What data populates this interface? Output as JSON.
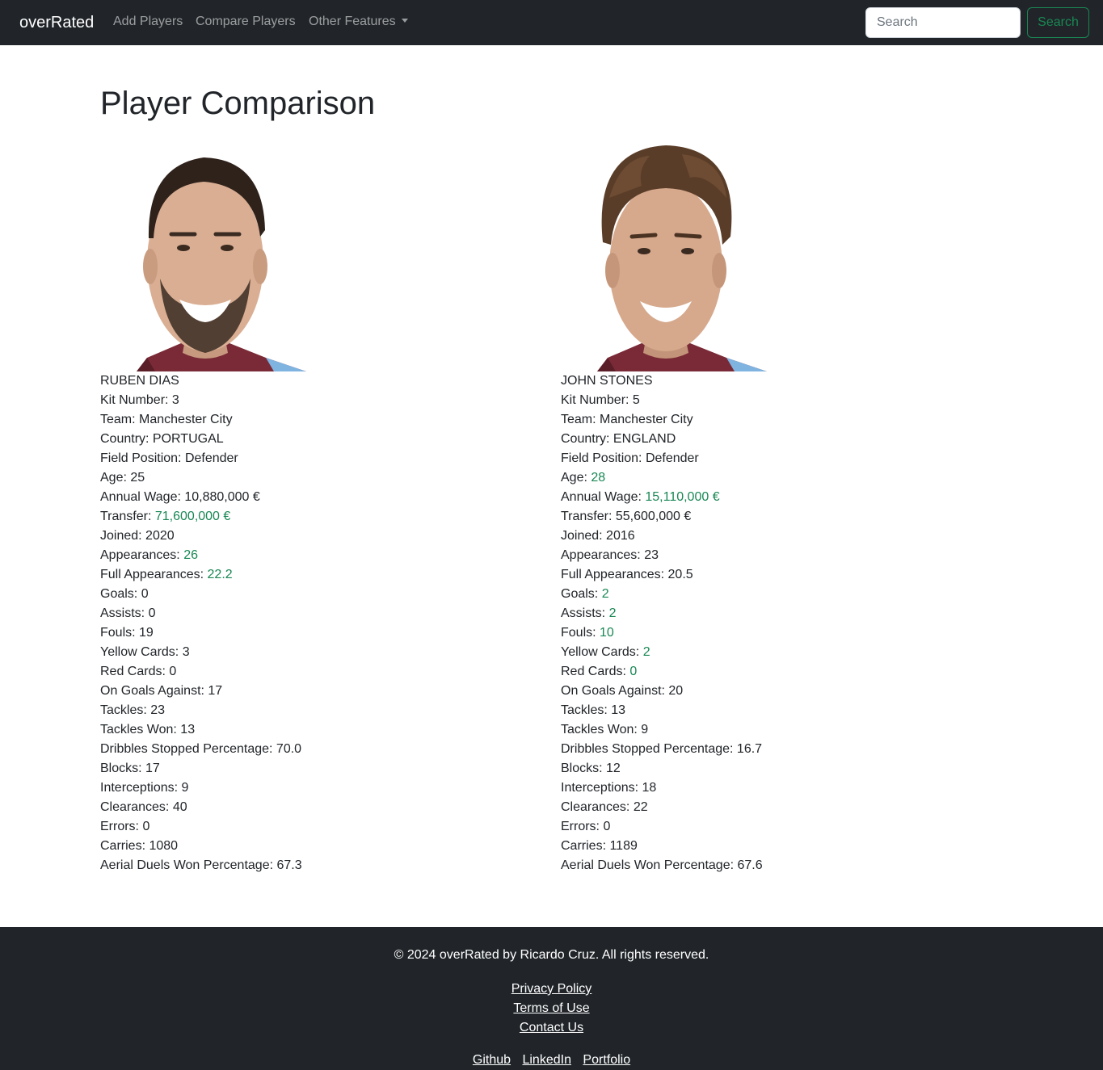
{
  "navbar": {
    "brand": "overRated",
    "links": [
      "Add Players",
      "Compare Players",
      "Other Features"
    ],
    "search_placeholder": "Search",
    "search_button": "Search"
  },
  "page": {
    "title": "Player Comparison"
  },
  "players": [
    {
      "name": "RUBEN DIAS",
      "stats": [
        {
          "label": "Kit Number: ",
          "value": "3",
          "better": false
        },
        {
          "label": "Team: ",
          "value": "Manchester City",
          "better": false
        },
        {
          "label": "Country: ",
          "value": "PORTUGAL",
          "better": false
        },
        {
          "label": "Field Position: ",
          "value": "Defender",
          "better": false
        },
        {
          "label": "Age: ",
          "value": "25",
          "better": false
        },
        {
          "label": "Annual Wage: ",
          "value": "10,880,000 €",
          "better": false
        },
        {
          "label": "Transfer: ",
          "value": "71,600,000 €",
          "better": true
        },
        {
          "label": "Joined: ",
          "value": "2020",
          "better": false
        },
        {
          "label": "Appearances: ",
          "value": "26",
          "better": true
        },
        {
          "label": "Full Appearances: ",
          "value": "22.2",
          "better": true
        },
        {
          "label": "Goals: ",
          "value": "0",
          "better": false
        },
        {
          "label": "Assists: ",
          "value": "0",
          "better": false
        },
        {
          "label": "Fouls: ",
          "value": "19",
          "better": false
        },
        {
          "label": "Yellow Cards: ",
          "value": "3",
          "better": false
        },
        {
          "label": "Red Cards: ",
          "value": "0",
          "better": false
        },
        {
          "label": "On Goals Against: ",
          "value": "17",
          "better": false
        },
        {
          "label": "Tackles: ",
          "value": "23",
          "better": false
        },
        {
          "label": "Tackles Won: ",
          "value": "13",
          "better": false
        },
        {
          "label": "Dribbles Stopped Percentage: ",
          "value": "70.0",
          "better": false
        },
        {
          "label": "Blocks: ",
          "value": "17",
          "better": false
        },
        {
          "label": "Interceptions: ",
          "value": "9",
          "better": false
        },
        {
          "label": "Clearances: ",
          "value": "40",
          "better": false
        },
        {
          "label": "Errors: ",
          "value": "0",
          "better": false
        },
        {
          "label": "Carries: ",
          "value": "1080",
          "better": false
        },
        {
          "label": "Aerial Duels Won Percentage: ",
          "value": "67.3",
          "better": false
        }
      ]
    },
    {
      "name": "JOHN STONES",
      "stats": [
        {
          "label": "Kit Number: ",
          "value": "5",
          "better": false
        },
        {
          "label": "Team: ",
          "value": "Manchester City",
          "better": false
        },
        {
          "label": "Country: ",
          "value": "ENGLAND",
          "better": false
        },
        {
          "label": "Field Position: ",
          "value": "Defender",
          "better": false
        },
        {
          "label": "Age: ",
          "value": "28",
          "better": true
        },
        {
          "label": "Annual Wage: ",
          "value": "15,110,000 €",
          "better": true
        },
        {
          "label": "Transfer: ",
          "value": "55,600,000 €",
          "better": false
        },
        {
          "label": "Joined: ",
          "value": "2016",
          "better": false
        },
        {
          "label": "Appearances: ",
          "value": "23",
          "better": false
        },
        {
          "label": "Full Appearances: ",
          "value": "20.5",
          "better": false
        },
        {
          "label": "Goals: ",
          "value": "2",
          "better": true
        },
        {
          "label": "Assists: ",
          "value": "2",
          "better": true
        },
        {
          "label": "Fouls: ",
          "value": "10",
          "better": true
        },
        {
          "label": "Yellow Cards: ",
          "value": "2",
          "better": true
        },
        {
          "label": "Red Cards: ",
          "value": "0",
          "better": true
        },
        {
          "label": "On Goals Against: ",
          "value": "20",
          "better": false
        },
        {
          "label": "Tackles: ",
          "value": "13",
          "better": false
        },
        {
          "label": "Tackles Won: ",
          "value": "9",
          "better": false
        },
        {
          "label": "Dribbles Stopped Percentage: ",
          "value": "16.7",
          "better": false
        },
        {
          "label": "Blocks: ",
          "value": "12",
          "better": false
        },
        {
          "label": "Interceptions: ",
          "value": "18",
          "better": false
        },
        {
          "label": "Clearances: ",
          "value": "22",
          "better": false
        },
        {
          "label": "Errors: ",
          "value": "0",
          "better": false
        },
        {
          "label": "Carries: ",
          "value": "1189",
          "better": false
        },
        {
          "label": "Aerial Duels Won Percentage: ",
          "value": "67.6",
          "better": false
        }
      ]
    }
  ],
  "footer": {
    "copyright": "© 2024 overRated by Ricardo Cruz. All rights reserved.",
    "links": [
      "Privacy Policy",
      "Terms of Use",
      "Contact Us"
    ],
    "social": [
      "Github",
      "LinkedIn",
      "Portfolio"
    ]
  },
  "colors": {
    "navbar_bg": "#212529",
    "accent_green": "#198754",
    "text": "#212529"
  }
}
